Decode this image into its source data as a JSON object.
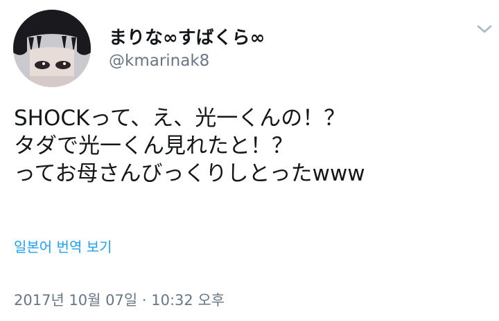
{
  "user": {
    "display_name": "まりな∞すばくら∞",
    "handle": "@kmarinak8"
  },
  "tweet": {
    "lines": [
      "SHOCKって、え、光一くんの！？",
      "タダで光一くん見れたと！？",
      "ってお母さんびっくりしとったwww"
    ],
    "translate_label": "일본어 번역 보기",
    "timestamp": "2017년 10월 07일 · 10:32 오후"
  },
  "icons": {
    "menu": "chevron-down-icon",
    "avatar": "avatar"
  },
  "colors": {
    "text": "#14171a",
    "secondary": "#657786",
    "link": "#1da1f2",
    "chevron": "#aab8c2"
  }
}
